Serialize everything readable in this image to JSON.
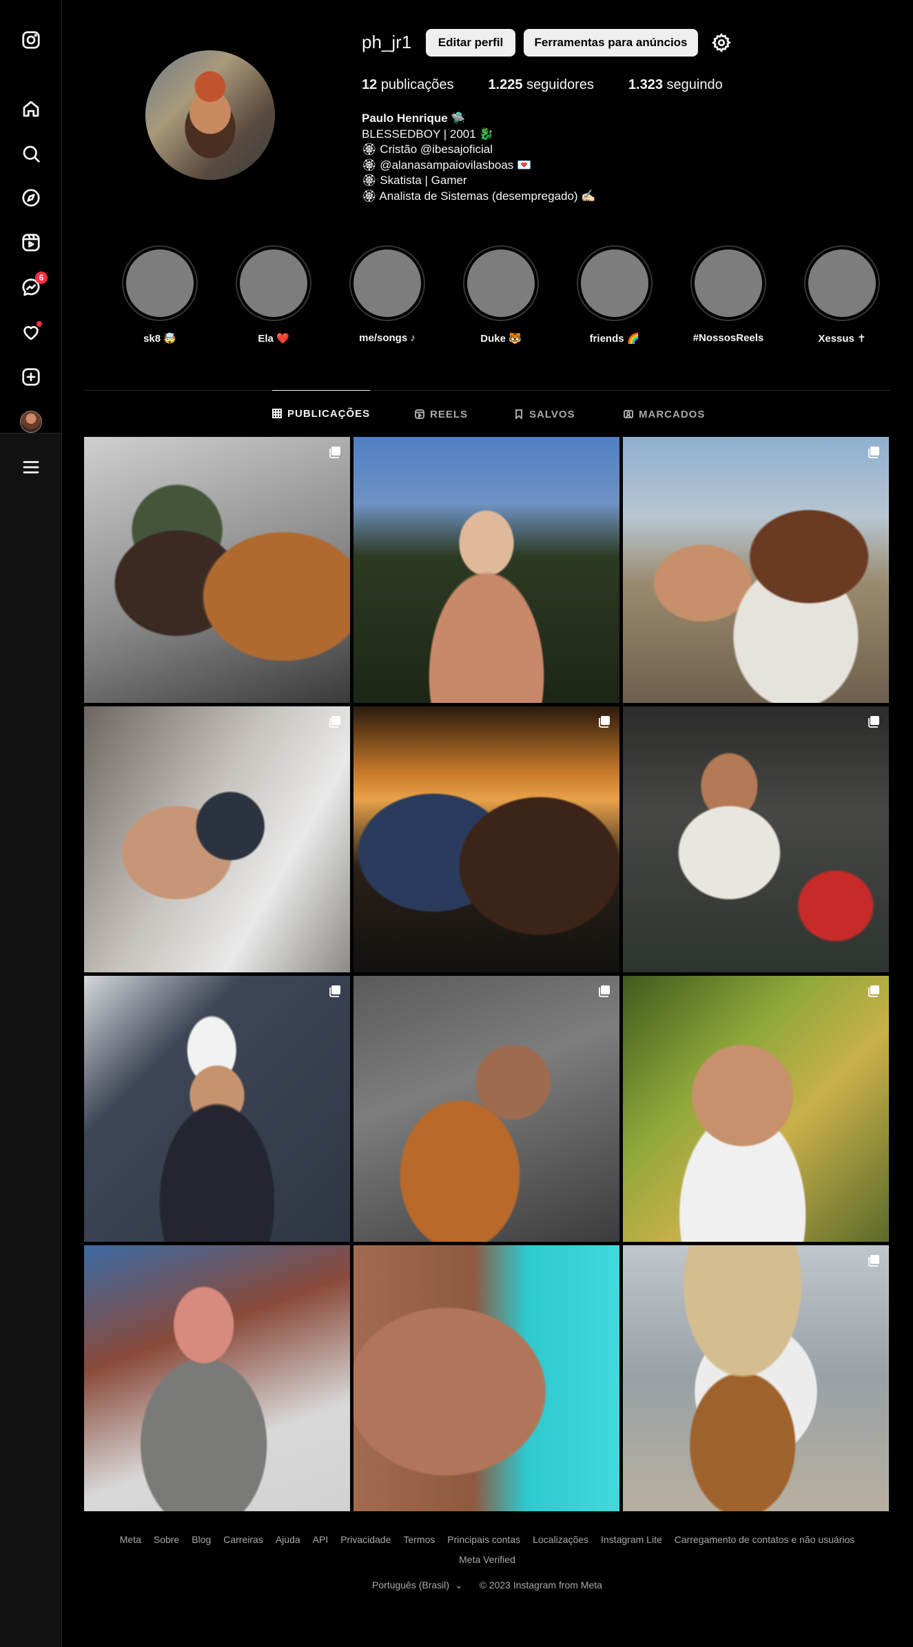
{
  "profile": {
    "username": "ph_jr1",
    "edit_button": "Editar perfil",
    "ads_button": "Ferramentas para anúncios",
    "stats": {
      "posts_count": "12",
      "posts_label": "publicações",
      "followers_count": "1.225",
      "followers_label": "seguidores",
      "following_count": "1.323",
      "following_label": "seguindo"
    },
    "bio": {
      "name": "Paulo Henrique 🛸",
      "lines": [
        "BLESSEDBOY | 2001 🐉",
        "🏵 Cristão @ibesajoficial",
        "🏵 @alanasampaiovilasboas 💌",
        "🏵 Skatista | Gamer",
        "🏵 Analista de Sistemas (desempregado) ✍🏻"
      ]
    }
  },
  "nav": {
    "messages_badge": "6"
  },
  "highlights": [
    {
      "label": "sk8 🤯"
    },
    {
      "label": "Ela ❤️"
    },
    {
      "label": "me/songs ♪"
    },
    {
      "label": "Duke 🐯"
    },
    {
      "label": "friends 🌈"
    },
    {
      "label": "#NossosReels"
    },
    {
      "label": "Xessus ✝"
    }
  ],
  "tabs": [
    {
      "label": "PUBLICAÇÕES",
      "icon": "grid-icon",
      "active": true
    },
    {
      "label": "REELS",
      "icon": "reels-icon",
      "active": false
    },
    {
      "label": "SALVOS",
      "icon": "bookmark-icon",
      "active": false
    },
    {
      "label": "MARCADOS",
      "icon": "tagged-icon",
      "active": false
    }
  ],
  "posts": [
    {
      "multi": true
    },
    {
      "multi": false
    },
    {
      "multi": true
    },
    {
      "multi": true
    },
    {
      "multi": true
    },
    {
      "multi": true
    },
    {
      "multi": true
    },
    {
      "multi": true
    },
    {
      "multi": true
    },
    {
      "multi": false
    },
    {
      "multi": false
    },
    {
      "multi": true
    }
  ],
  "footer": {
    "links": [
      "Meta",
      "Sobre",
      "Blog",
      "Carreiras",
      "Ajuda",
      "API",
      "Privacidade",
      "Termos",
      "Principais contas",
      "Localizações",
      "Instagram Lite",
      "Carregamento de contatos e não usuários",
      "Meta Verified"
    ],
    "language": "Português (Brasil)",
    "copyright": "© 2023 Instagram from Meta"
  },
  "colors": {
    "background": "#000000",
    "sidebar": "#121212",
    "badge": "#ff3040",
    "muted_text": "#a8a8a8"
  }
}
